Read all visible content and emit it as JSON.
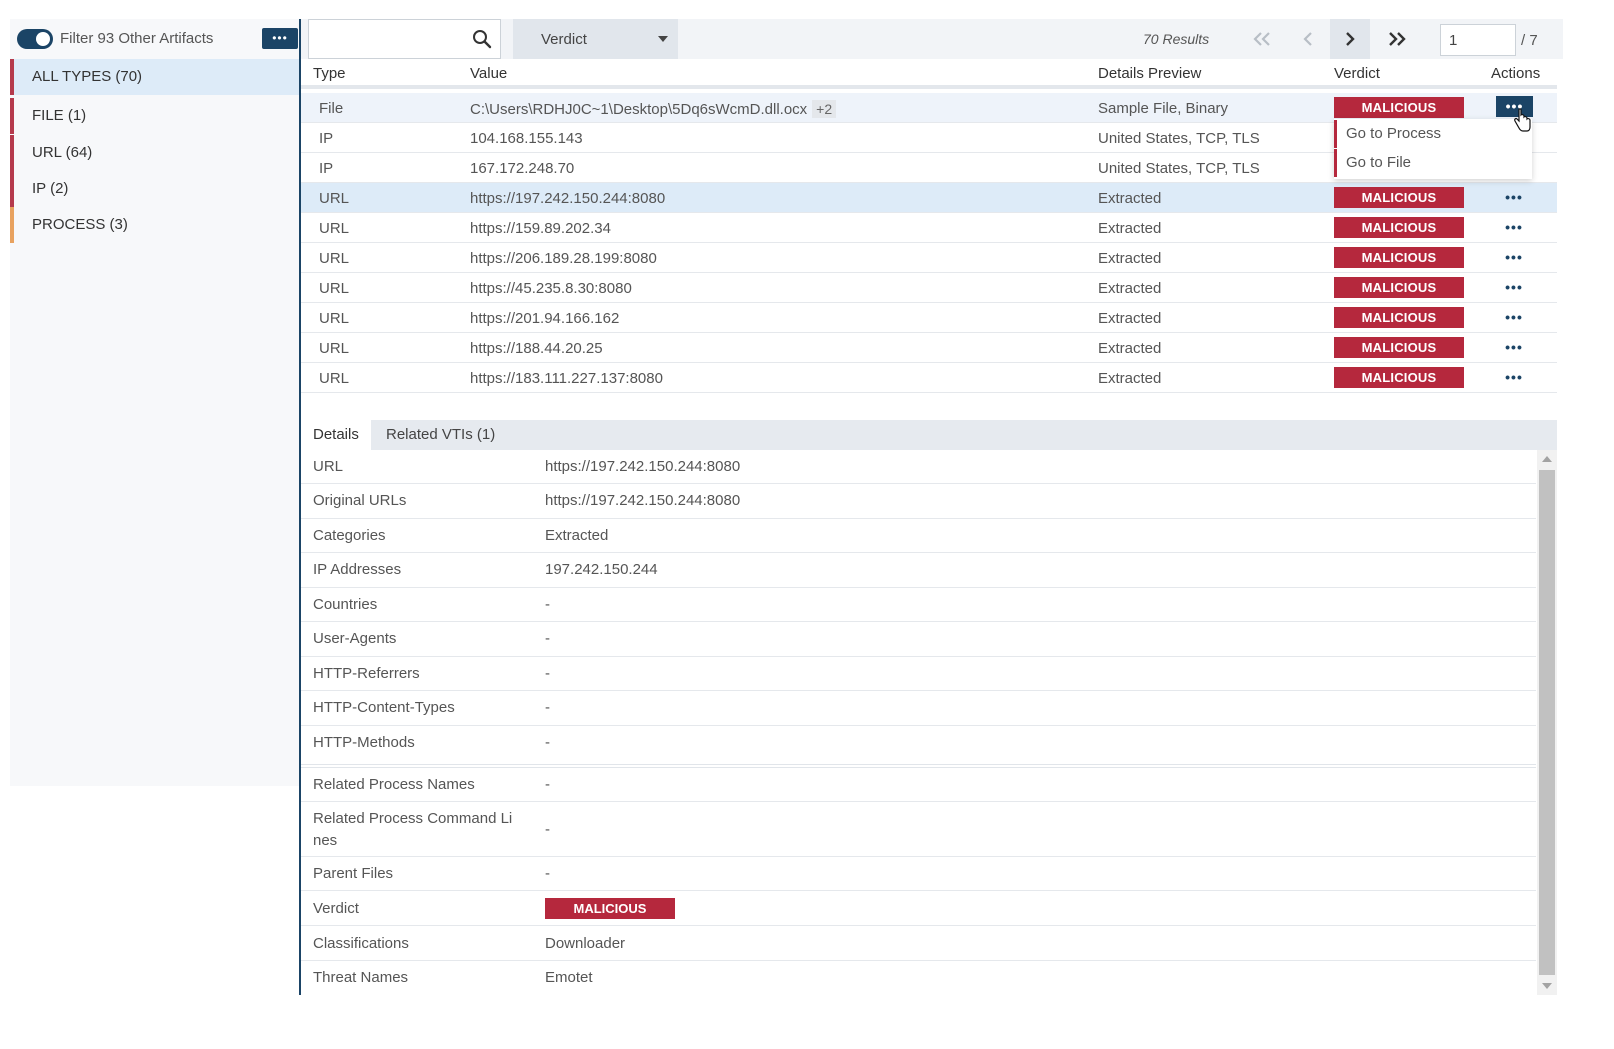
{
  "sidebar": {
    "filter_label": "Filter 93 Other Artifacts",
    "more_label": "•••",
    "types": [
      {
        "label": "ALL TYPES (70)"
      },
      {
        "label": "FILE (1)"
      },
      {
        "label": "URL (64)"
      },
      {
        "label": "IP (2)"
      },
      {
        "label": "PROCESS (3)"
      }
    ]
  },
  "toolbar": {
    "search_value": "",
    "verdict_label": "Verdict",
    "results": "70 Results",
    "page_value": "1",
    "page_total": "/ 7"
  },
  "table": {
    "headers": {
      "type": "Type",
      "value": "Value",
      "details": "Details Preview",
      "verdict": "Verdict",
      "actions": "Actions"
    },
    "rows": [
      {
        "type": "File",
        "value": "C:\\Users\\RDHJ0C~1\\Desktop\\5Dq6sWcmD.dll.ocx",
        "extra": "+2",
        "details": "Sample File, Binary",
        "verdict": "MALICIOUS",
        "dots": "•••"
      },
      {
        "type": "IP",
        "value": "104.168.155.143",
        "details": "United States, TCP, TLS",
        "verdict": "",
        "dots": ""
      },
      {
        "type": "IP",
        "value": "167.172.248.70",
        "details": "United States, TCP, TLS",
        "verdict": "",
        "dots": ""
      },
      {
        "type": "URL",
        "value": "https://197.242.150.244:8080",
        "details": "Extracted",
        "verdict": "MALICIOUS",
        "dots": "•••"
      },
      {
        "type": "URL",
        "value": "https://159.89.202.34",
        "details": "Extracted",
        "verdict": "MALICIOUS",
        "dots": "•••"
      },
      {
        "type": "URL",
        "value": "https://206.189.28.199:8080",
        "details": "Extracted",
        "verdict": "MALICIOUS",
        "dots": "•••"
      },
      {
        "type": "URL",
        "value": "https://45.235.8.30:8080",
        "details": "Extracted",
        "verdict": "MALICIOUS",
        "dots": "•••"
      },
      {
        "type": "URL",
        "value": "https://201.94.166.162",
        "details": "Extracted",
        "verdict": "MALICIOUS",
        "dots": "•••"
      },
      {
        "type": "URL",
        "value": "https://188.44.20.25",
        "details": "Extracted",
        "verdict": "MALICIOUS",
        "dots": "•••"
      },
      {
        "type": "URL",
        "value": "https://183.111.227.137:8080",
        "details": "Extracted",
        "verdict": "MALICIOUS",
        "dots": "•••"
      }
    ]
  },
  "action_menu": {
    "go_to_process": "Go to Process",
    "go_to_file": "Go to File"
  },
  "tabs": {
    "details": "Details",
    "related": "Related VTIs (1)"
  },
  "details": [
    {
      "key": "URL",
      "value": "https://197.242.150.244:8080"
    },
    {
      "key": "Original URLs",
      "value": "https://197.242.150.244:8080"
    },
    {
      "key": "Categories",
      "value": "Extracted"
    },
    {
      "key": "IP Addresses",
      "value": "197.242.150.244"
    },
    {
      "key": "Countries",
      "value": "-"
    },
    {
      "key": "User-Agents",
      "value": "-"
    },
    {
      "key": "HTTP-Referrers",
      "value": "-"
    },
    {
      "key": "HTTP-Content-Types",
      "value": "-"
    },
    {
      "key": "HTTP-Methods",
      "value": "-"
    },
    {
      "key": "Related Process Names",
      "value": "-"
    },
    {
      "key": "Related Process Command Li nes",
      "value": "-"
    },
    {
      "key": "Parent Files",
      "value": "-"
    },
    {
      "key": "Verdict",
      "value": "MALICIOUS"
    },
    {
      "key": "Classifications",
      "value": "Downloader"
    },
    {
      "key": "Threat Names",
      "value": "Emotet"
    }
  ],
  "colors": {
    "accent": "#1b4466",
    "malicious": "#b5283d",
    "selected_row": "#ddebf8",
    "process_marker": "#e8a25f"
  }
}
